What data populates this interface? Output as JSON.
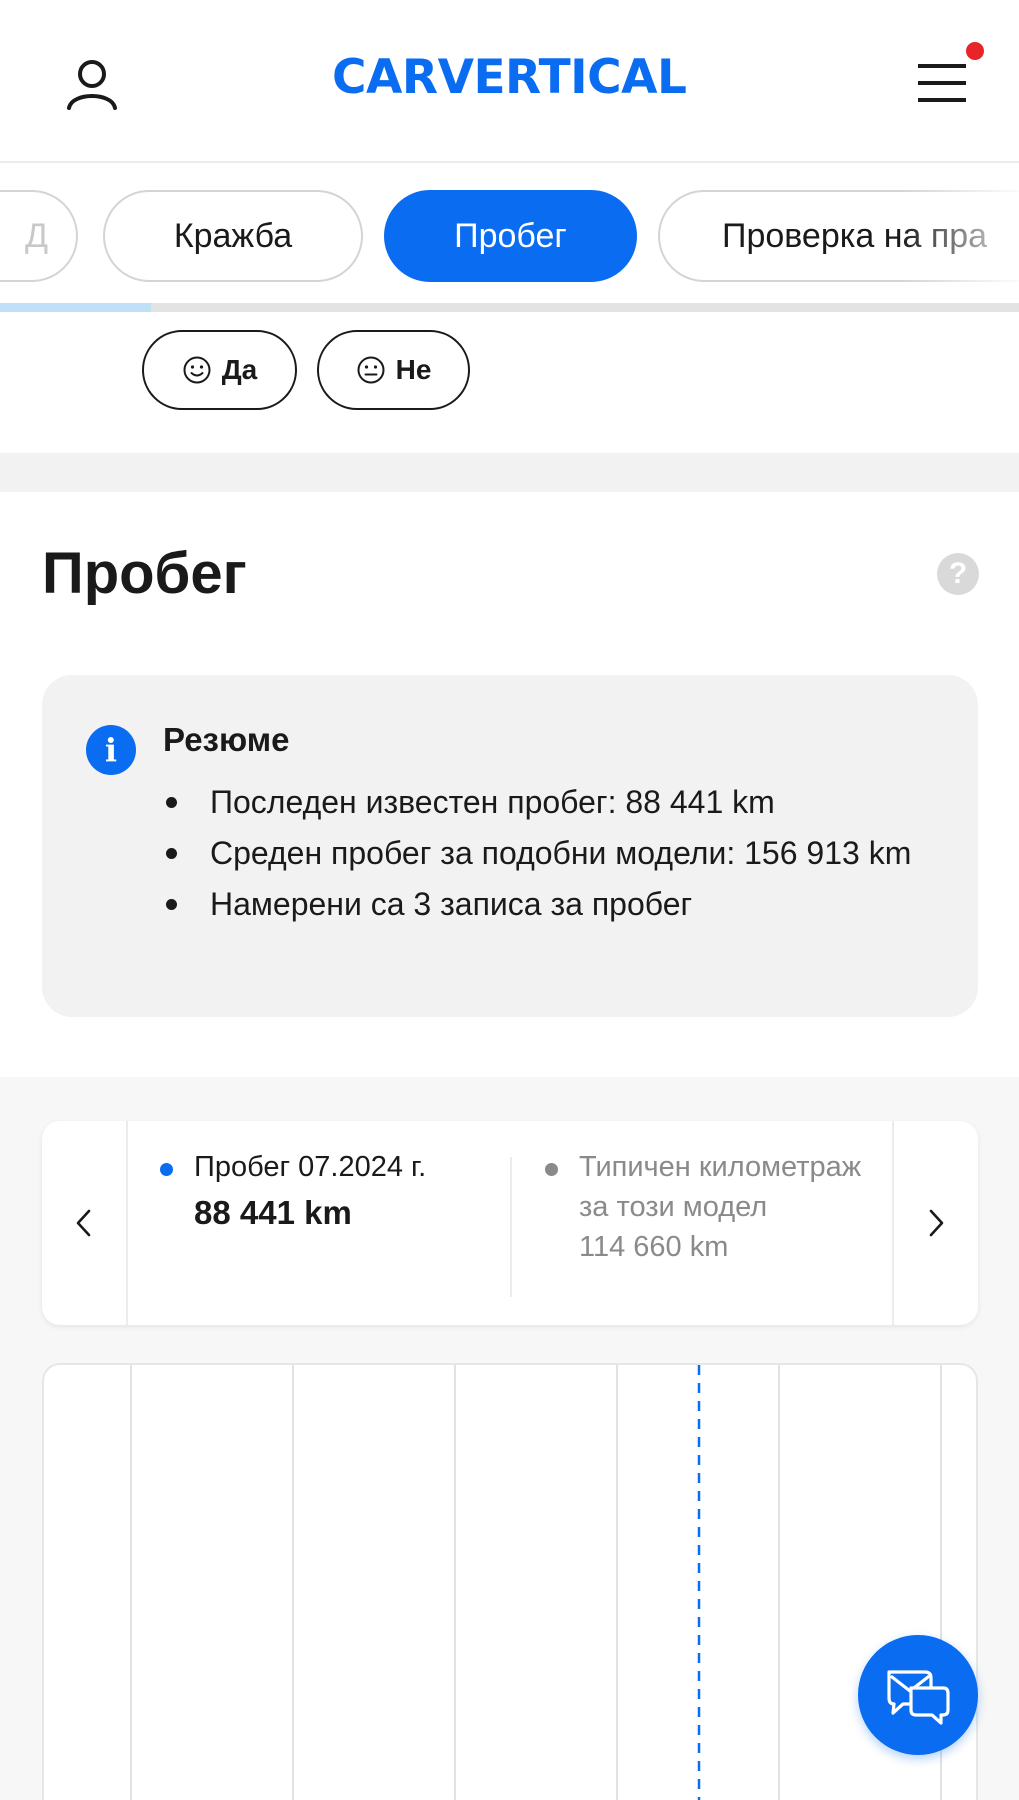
{
  "header": {
    "logo_text": "CARVERTICAL",
    "logo_parts": [
      "CAR",
      "V",
      "ERTICAL"
    ],
    "brand_color": "#0a6cf0",
    "notification_color": "#e8242b"
  },
  "tabs": [
    {
      "label": "Д",
      "active": false
    },
    {
      "label": "Кражба",
      "active": false
    },
    {
      "label": "Пробег",
      "active": true
    },
    {
      "label": "Проверка на пра",
      "active": false
    }
  ],
  "feedback": {
    "yes_label": "Да",
    "no_label": "Не"
  },
  "section": {
    "title": "Пробег",
    "help_symbol": "?"
  },
  "summary": {
    "icon_symbol": "i",
    "title": "Резюме",
    "items": [
      "Последен известен пробег: 88 441 km",
      "Среден пробег за подобни модели: 156 913 km",
      "Намерени са 3 записа за пробег"
    ]
  },
  "readout": {
    "current": {
      "label": "Пробег 07.2024 г.",
      "value": "88 441 km",
      "dot_color": "#0a6cf0"
    },
    "typical": {
      "label": "Типичен километраж за този модел",
      "value": "114 660 km",
      "dot_color": "#8a8a8a"
    }
  },
  "chart_data": {
    "type": "line",
    "title": "",
    "xlabel": "",
    "ylabel": "",
    "grid": true,
    "series": []
  }
}
